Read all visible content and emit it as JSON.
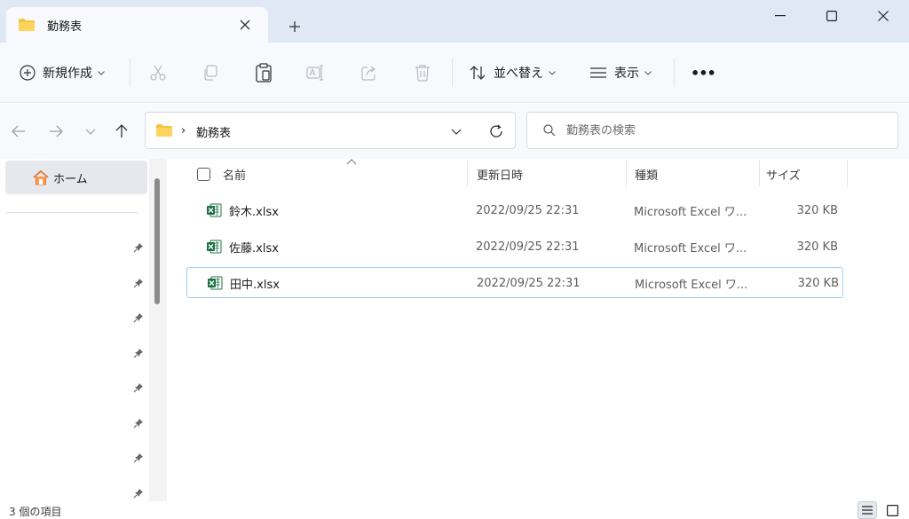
{
  "window": {
    "tab_title": "勤務表",
    "tab_icon": "folder-icon",
    "new_tab": "+"
  },
  "toolbar": {
    "new_label": "新規作成",
    "sort_label": "並べ替え",
    "view_label": "表示",
    "more_label": "•••"
  },
  "address": {
    "separator": "›",
    "path": "勤務表"
  },
  "search": {
    "placeholder": "勤務表の検索"
  },
  "nav": {
    "home_label": "ホーム",
    "pinned_count": 8
  },
  "columns": {
    "name": "名前",
    "date": "更新日時",
    "type": "種類",
    "size": "サイズ"
  },
  "files": [
    {
      "name": "鈴木.xlsx",
      "date": "2022/09/25 22:31",
      "type": "Microsoft Excel ワ...",
      "size": "320 KB"
    },
    {
      "name": "佐藤.xlsx",
      "date": "2022/09/25 22:31",
      "type": "Microsoft Excel ワ...",
      "size": "320 KB"
    },
    {
      "name": "田中.xlsx",
      "date": "2022/09/25 22:31",
      "type": "Microsoft Excel ワ...",
      "size": "320 KB"
    }
  ],
  "status": {
    "count": "3 個の項目"
  },
  "colors": {
    "titlebar": "#dfe8f4",
    "toolbar": "#f7f9fc",
    "folder": "#f5c242",
    "excel": "#1d7044",
    "selection_border": "#a3cdf0"
  }
}
